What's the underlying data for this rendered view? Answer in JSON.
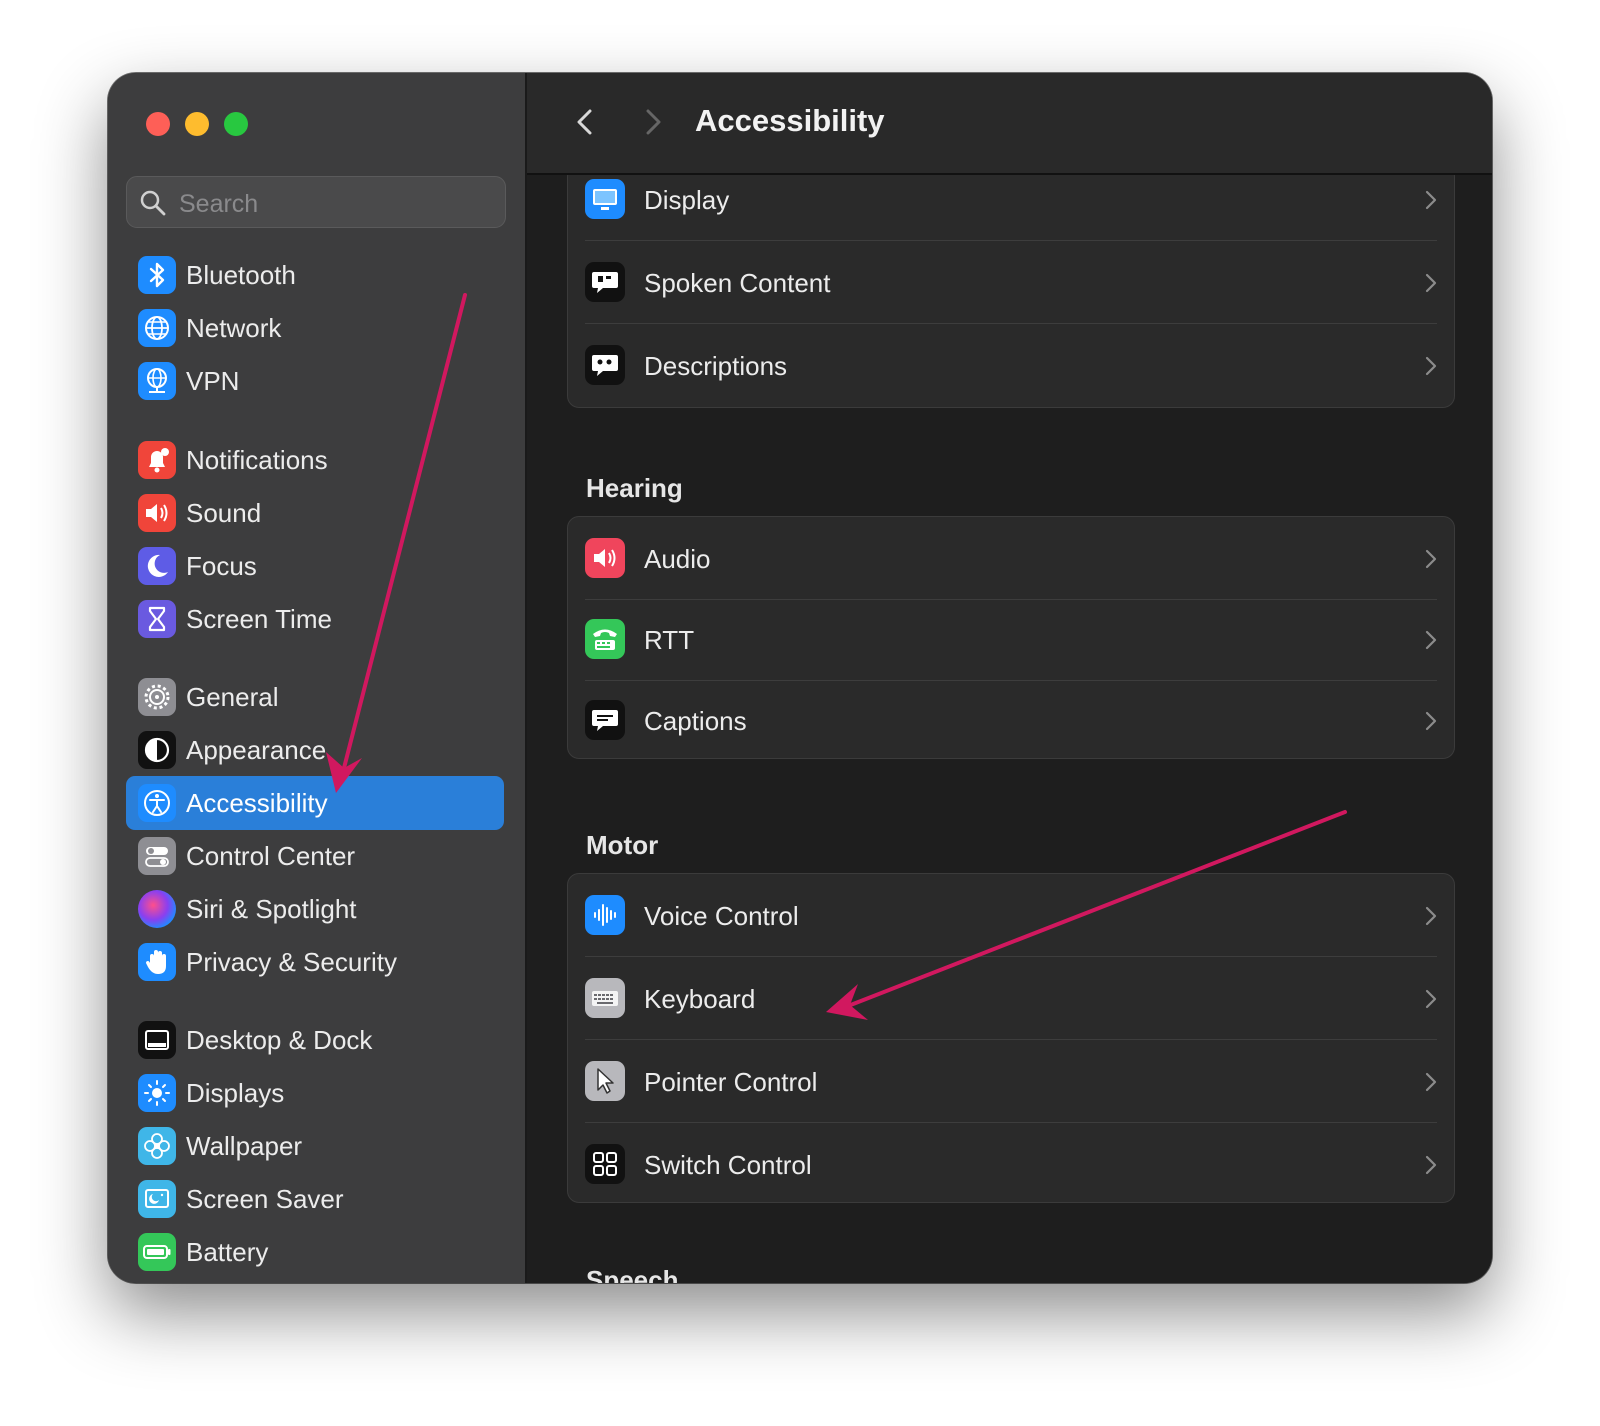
{
  "window": {
    "title": "Accessibility"
  },
  "search": {
    "placeholder": "Search"
  },
  "sidebar": {
    "items": [
      {
        "label": "Bluetooth",
        "icon": "bluetooth-icon",
        "color": "#1e8cff"
      },
      {
        "label": "Network",
        "icon": "globe-icon",
        "color": "#1e8cff"
      },
      {
        "label": "VPN",
        "icon": "vpn-globe-icon",
        "color": "#1e8cff"
      },
      {
        "label": "Notifications",
        "icon": "bell-icon",
        "color": "#f0453a"
      },
      {
        "label": "Sound",
        "icon": "speaker-icon",
        "color": "#f0453a"
      },
      {
        "label": "Focus",
        "icon": "moon-icon",
        "color": "#5e5ce6"
      },
      {
        "label": "Screen Time",
        "icon": "hourglass-icon",
        "color": "#6a5ae0"
      },
      {
        "label": "General",
        "icon": "gear-icon",
        "color": "#8e8e93"
      },
      {
        "label": "Appearance",
        "icon": "appearance-icon",
        "color": "#111111"
      },
      {
        "label": "Accessibility",
        "icon": "accessibility-icon",
        "color": "#1e8cff",
        "selected": true
      },
      {
        "label": "Control Center",
        "icon": "toggles-icon",
        "color": "#8e8e93"
      },
      {
        "label": "Siri & Spotlight",
        "icon": "siri-icon",
        "color": "#5a3fd1"
      },
      {
        "label": "Privacy & Security",
        "icon": "hand-icon",
        "color": "#1e8cff"
      },
      {
        "label": "Desktop & Dock",
        "icon": "dock-icon",
        "color": "#111111"
      },
      {
        "label": "Displays",
        "icon": "sun-icon",
        "color": "#1e8cff"
      },
      {
        "label": "Wallpaper",
        "icon": "flower-icon",
        "color": "#3fb6e8"
      },
      {
        "label": "Screen Saver",
        "icon": "screensaver-icon",
        "color": "#3fb6e8"
      },
      {
        "label": "Battery",
        "icon": "battery-icon",
        "color": "#34c759"
      }
    ]
  },
  "main": {
    "vision_group": [
      {
        "label": "Display",
        "icon": "monitor-icon",
        "color": "#1e8cff"
      },
      {
        "label": "Spoken Content",
        "icon": "speech-bubble-icon",
        "color": "#111111"
      },
      {
        "label": "Descriptions",
        "icon": "quote-bubble-icon",
        "color": "#111111"
      }
    ],
    "hearing": {
      "title": "Hearing",
      "items": [
        {
          "label": "Audio",
          "icon": "speaker-icon",
          "color": "#f0455c"
        },
        {
          "label": "RTT",
          "icon": "tty-icon",
          "color": "#34c759"
        },
        {
          "label": "Captions",
          "icon": "captions-icon",
          "color": "#111111"
        }
      ]
    },
    "motor": {
      "title": "Motor",
      "items": [
        {
          "label": "Voice Control",
          "icon": "waveform-icon",
          "color": "#1e8cff"
        },
        {
          "label": "Keyboard",
          "icon": "keyboard-icon",
          "color": "#b8b8bc"
        },
        {
          "label": "Pointer Control",
          "icon": "pointer-icon",
          "color": "#b8b8bc"
        },
        {
          "label": "Switch Control",
          "icon": "grid-icon",
          "color": "#111111"
        }
      ]
    },
    "next_section": "Speech"
  },
  "annotation_color": "#d1185f"
}
